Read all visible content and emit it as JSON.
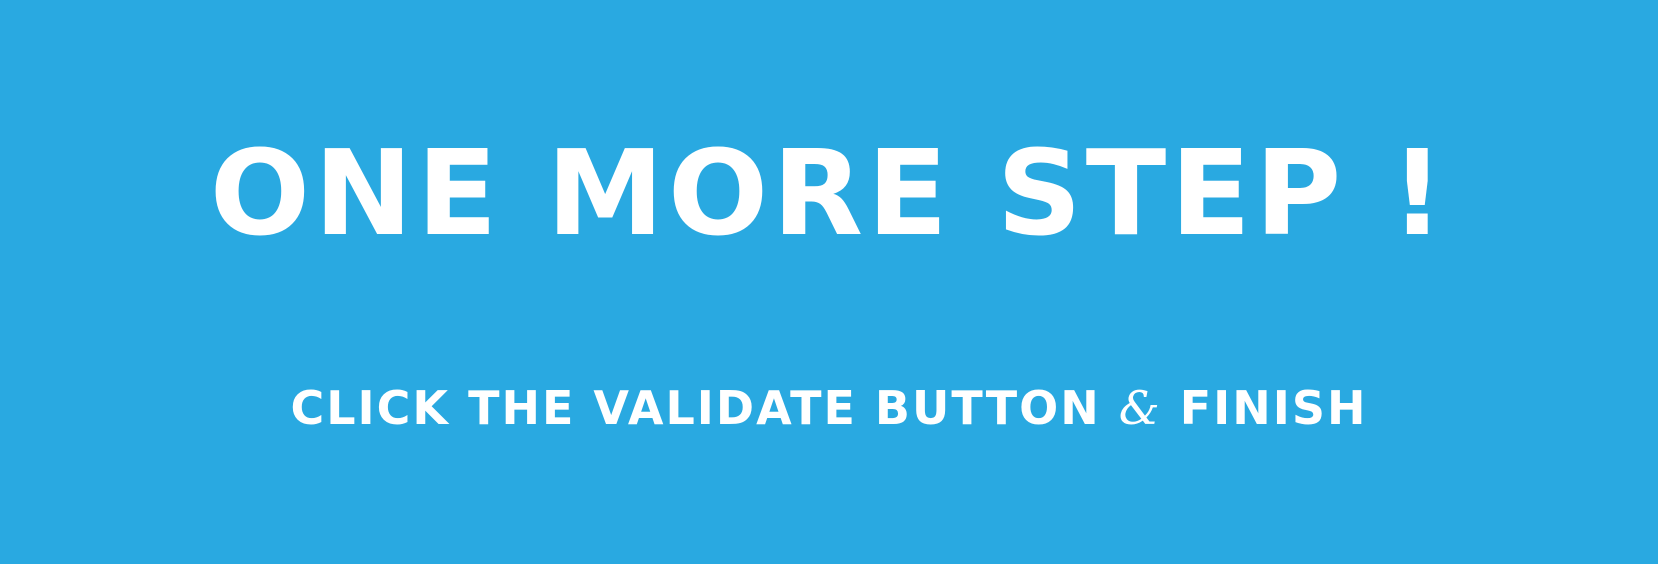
{
  "banner": {
    "headline": "ONE MORE STEP !",
    "subline_before": "CLICK THE VALIDATE BUTTON",
    "subline_amp": "&",
    "subline_after": "FINISH",
    "colors": {
      "background": "#29a9e1",
      "text": "#ffffff"
    }
  }
}
